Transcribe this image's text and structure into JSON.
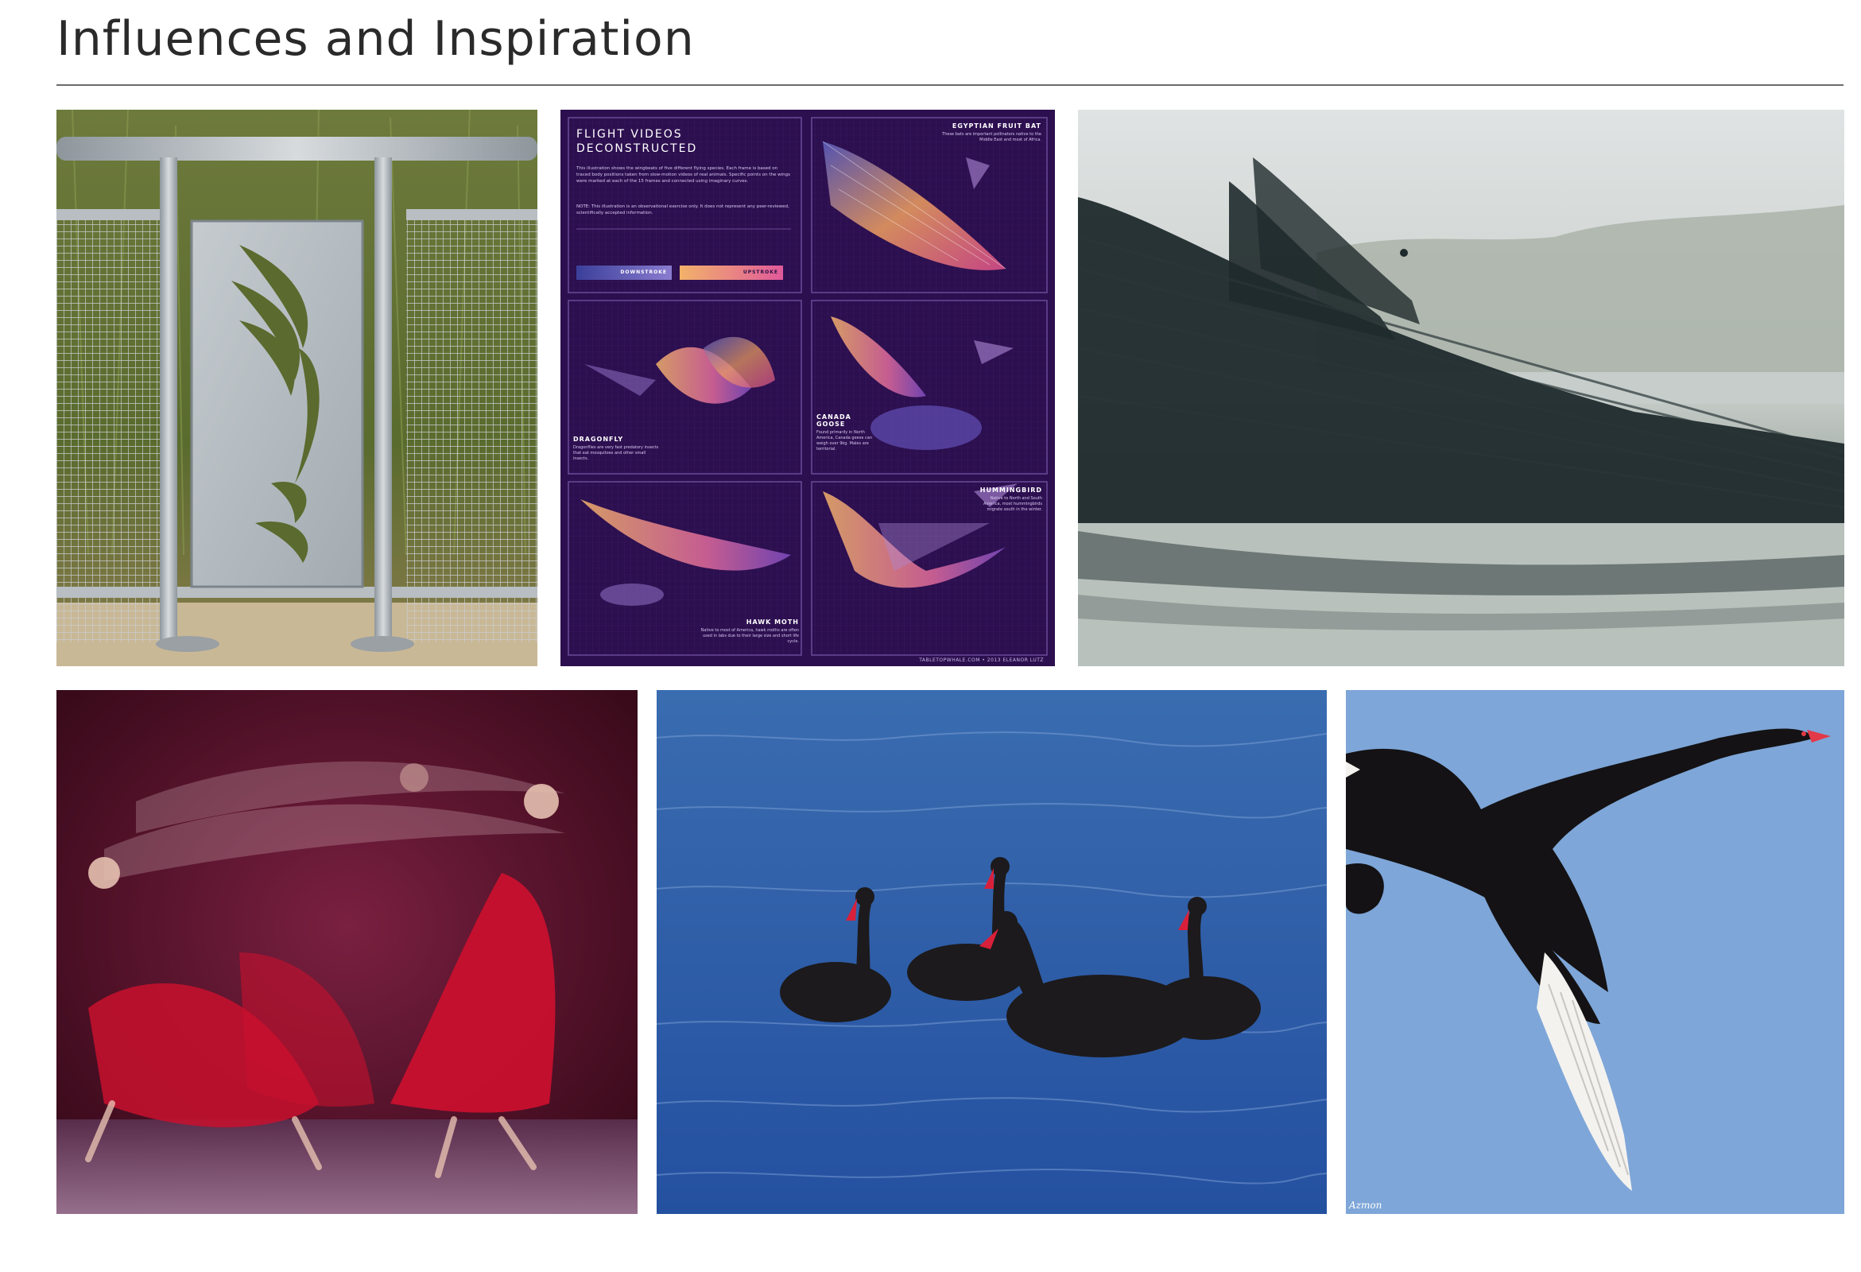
{
  "page": {
    "title": "Influences and Inspiration"
  },
  "infographic": {
    "title_line1": "FLIGHT VIDEOS",
    "title_line2": "DECONSTRUCTED",
    "intro": "This illustration shows the wingbeats of five different flying species. Each frame is based on traced body positions taken from slow-motion videos of real animals. Specific points on the wings were marked at each of the 15 frames and connected using imaginary curves.",
    "note": "NOTE: This illustration is an observational exercise only. It does not represent any peer-reviewed, scientifically accepted information.",
    "downstroke_label": "DOWNSTROKE",
    "upstroke_label": "UPSTROKE",
    "species": [
      {
        "name": "EGYPTIAN FRUIT BAT",
        "desc": "These bats are important pollinators native to the Middle East and most of Africa."
      },
      {
        "name": "DRAGONFLY",
        "desc": "Dragonflies are very fast predatory insects that eat mosquitoes and other small insects."
      },
      {
        "name": "CANADA GOOSE",
        "desc": "Found primarily in North America, Canada geese can weigh over 9kg. Males are territorial."
      },
      {
        "name": "HAWK MOTH",
        "desc": "Native to most of America, hawk moths are often used in labs due to their large size and short life cycle."
      },
      {
        "name": "HUMMINGBIRD",
        "desc": "Native to North and South America, most hummingbirds migrate south in the winter."
      }
    ],
    "footer": "TABLETOPWHALE.COM • 2013 ELEANOR LUTZ"
  },
  "photos": {
    "railing": {
      "icon": "railing-bird-cutout-image"
    },
    "birds": {
      "icon": "bird-flight-motion-image"
    },
    "dancers": {
      "icon": "dancers-motion-blur-image"
    },
    "swans": {
      "icon": "black-swans-swimming-image"
    },
    "flying_swan": {
      "icon": "flying-black-swan-image",
      "watermark": "Azmon"
    }
  },
  "colors": {
    "infographic_bg": "#2c0f4f",
    "downstroke": "#4b4fa8",
    "upstroke": "#f0a060",
    "sky_blue": "#7ea6d8",
    "water_blue": "#2d5fa8",
    "dancer_red": "#c8102e"
  }
}
